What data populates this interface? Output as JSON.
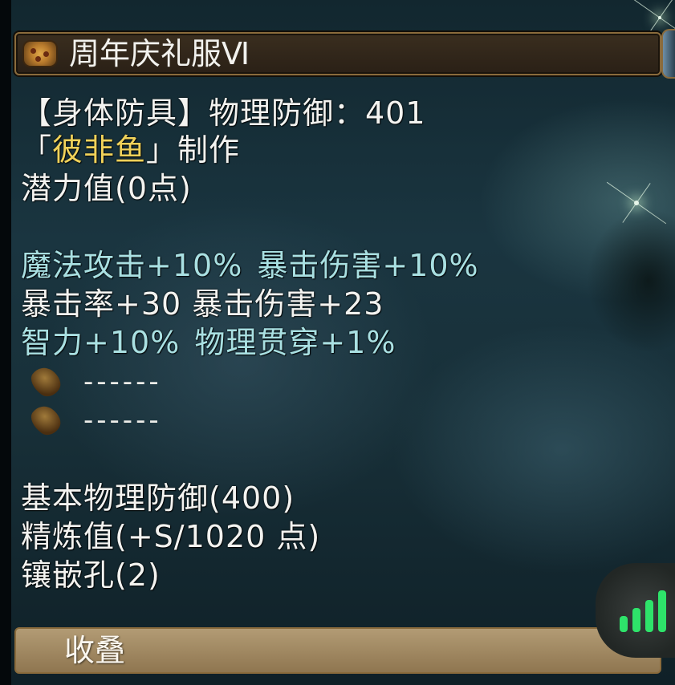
{
  "item": {
    "name": "周年庆礼服Ⅵ",
    "header_line": "【身体防具】物理防御：401",
    "maker_open": "「",
    "maker_name": "彼非鱼",
    "maker_close": "」制作",
    "potential": "潜力值(0点)"
  },
  "stats": {
    "line1_a": "魔法攻击+10%",
    "line1_b": "暴击伤害+10%",
    "line2": "暴击率+30 暴击伤害+23",
    "line3_a": "智力+10%",
    "line3_b": "物理贯穿+1%"
  },
  "slots": [
    "------",
    "------"
  ],
  "base": {
    "phys_def": "基本物理防御(400)",
    "refine": "精炼值(+S/1020 点)",
    "sockets": "镶嵌孔(2)"
  },
  "collapse_label": "收叠",
  "colors": {
    "special_stat": "#a9e0e2",
    "maker_name": "#f0d25a",
    "panel_border": "#8a6b3c",
    "signal": "#2ee36a"
  },
  "icons": {
    "title": "item-medal-icon",
    "slot": "seed-socket-icon",
    "network": "signal-bars-icon"
  }
}
